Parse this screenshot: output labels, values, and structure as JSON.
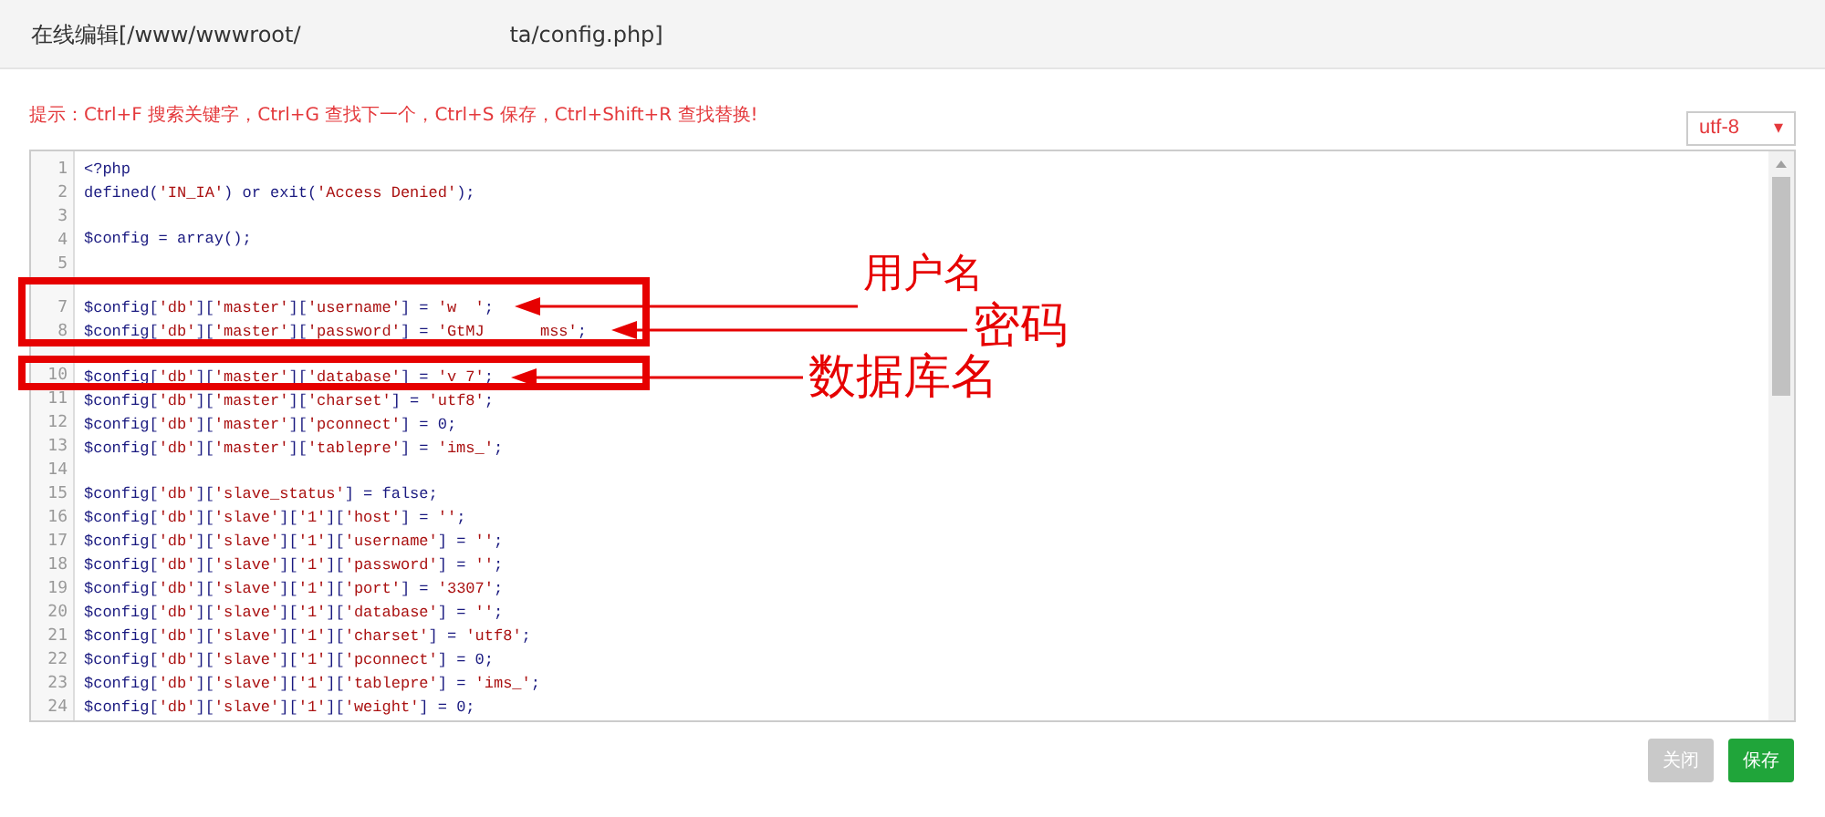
{
  "window": {
    "title": "在线编辑[/www/wwwroot/                              ta/config.php]"
  },
  "hint": "提示：Ctrl+F 搜索关键字，Ctrl+G 查找下一个，Ctrl+S 保存，Ctrl+Shift+R 查找替换!",
  "encoding": {
    "value": "utf-8",
    "arrow": "▾"
  },
  "editor": {
    "lines": [
      {
        "number": "1",
        "code": "<?php"
      },
      {
        "number": "2",
        "code": "defined('IN_IA') or exit('Access Denied');"
      },
      {
        "number": "3"
      },
      {
        "number": "4",
        "code": "$config = array();"
      },
      {
        "number": "5"
      },
      {
        "number": "7",
        "code": "$config['db']['master']['username'] = 'w  ';"
      },
      {
        "number": "8",
        "code": "$config['db']['master']['password'] = 'GtMJ      mss';"
      },
      {
        "number": "10",
        "code": "$config['db']['master']['database'] = 'v 7';"
      },
      {
        "number": "11",
        "code": "$config['db']['master']['charset'] = 'utf8';"
      },
      {
        "number": "12",
        "code": "$config['db']['master']['pconnect'] = 0;"
      },
      {
        "number": "13",
        "code": "$config['db']['master']['tablepre'] = 'ims_';"
      },
      {
        "number": "14"
      },
      {
        "number": "15",
        "code": "$config['db']['slave_status'] = false;"
      },
      {
        "number": "16",
        "code": "$config['db']['slave']['1']['host'] = '';"
      },
      {
        "number": "17",
        "code": "$config['db']['slave']['1']['username'] = '';"
      },
      {
        "number": "18",
        "code": "$config['db']['slave']['1']['password'] = '';"
      },
      {
        "number": "19",
        "code": "$config['db']['slave']['1']['port'] = '3307';"
      },
      {
        "number": "20",
        "code": "$config['db']['slave']['1']['database'] = '';"
      },
      {
        "number": "21",
        "code": "$config['db']['slave']['1']['charset'] = 'utf8';"
      },
      {
        "number": "22",
        "code": "$config['db']['slave']['1']['pconnect'] = 0;"
      },
      {
        "number": "23",
        "code": "$config['db']['slave']['1']['tablepre'] = 'ims_';"
      },
      {
        "number": "24",
        "code": "$config['db']['slave']['1']['weight'] = 0;"
      }
    ]
  },
  "annotations": [
    {
      "label": "用户名"
    },
    {
      "label": "密码"
    },
    {
      "label": "数据库名"
    }
  ],
  "buttons": [
    {
      "label": "关闭",
      "kind": "secondary"
    },
    {
      "label": "保存",
      "kind": "primary"
    }
  ]
}
